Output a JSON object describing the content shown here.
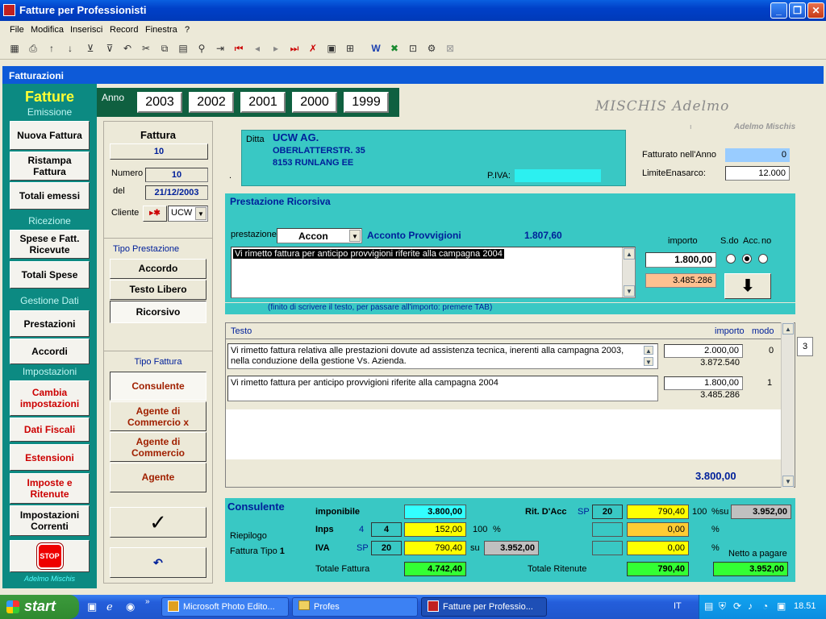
{
  "window": {
    "title": "Fatture per Professionisti"
  },
  "menu": [
    "File",
    "Modifica",
    "Inserisci",
    "Record",
    "Finestra",
    "?"
  ],
  "form": {
    "title": "Fatturazioni"
  },
  "nav": {
    "fatture": "Fatture",
    "emissione": "Emissione",
    "nuova_fattura": "Nuova Fattura",
    "ristampa_fattura": "Ristampa Fattura",
    "totali_emessi": "Totali emessi",
    "ricezione": "Ricezione",
    "spese_ricevute": "Spese e Fatt. Ricevute",
    "totali_spese": "Totali Spese",
    "gestione_dati": "Gestione Dati",
    "prestazioni": "Prestazioni",
    "accordi": "Accordi",
    "impostazioni": "Impostazioni",
    "cambia_impostazioni": "Cambia impostazioni",
    "dati_fiscali": "Dati Fiscali",
    "estensioni": "Estensioni",
    "imposte_ritenute": "Imposte e Ritenute",
    "impostazioni_correnti": "Impostazioni Correnti",
    "stop": "STOP",
    "signature": "Adelmo Mischis"
  },
  "years": {
    "label": "Anno",
    "items": [
      "2003",
      "2002",
      "2001",
      "2000",
      "1999"
    ]
  },
  "header": {
    "name": "MISCHIS Adelmo",
    "name_small": "Adelmo Mischis",
    "mark": "ı"
  },
  "invoice": {
    "fattura_label": "Fattura",
    "fattura_value": "10",
    "numero_label": "Numero",
    "numero_value": "10",
    "del_label": "del",
    "del_value": "21/12/2003",
    "cliente_label": "Cliente",
    "cliente_value": "UCW"
  },
  "ditta": {
    "label": "Ditta",
    "line1": "UCW AG.",
    "line2": "OBERLATTERSTR. 35",
    "line3": "8153 RUNLANG  EE",
    "piva_label": "P.IVA:",
    "dot": "."
  },
  "fatturato": {
    "label": "Fatturato nell'Anno",
    "value": "0",
    "limite_label": "LimiteEnasarco:",
    "limite_value": "12.000"
  },
  "tipo_prestazione": {
    "label": "Tipo Prestazione",
    "accordo": "Accordo",
    "testo_libero": "Testo Libero",
    "ricorsivo": "Ricorsivo"
  },
  "tipo_fattura": {
    "label": "Tipo Fattura",
    "consulente": "Consulente",
    "agente_x": "Agente di Commercio x",
    "agente_comm": "Agente di Commercio",
    "agente": "Agente"
  },
  "prestazione_ricorsiva": {
    "title": "Prestazione Ricorsiva",
    "prestazione_label": "prestazione",
    "prestazione_value": "Accon",
    "description": "Acconto Provvigioni",
    "amount": "1.807,60",
    "importo_label": "importo",
    "sdo_label": "S.do",
    "acc_label": "Acc.",
    "no_label": "no",
    "text": "Vi rimetto fattura per anticipo provvigioni riferite alla campagna 2004",
    "importo_value": "1.800,00",
    "saldo_value": "3.485.286",
    "hint": "(finito di scrivere il testo, per passare all'importo: premere TAB)"
  },
  "righe": {
    "testo_label": "Testo",
    "importo_label": "importo",
    "modo_label": "modo",
    "rows": [
      {
        "text": "Vi rimetto fattura relativa alle prestazioni dovute ad assistenza tecnica, inerenti alla campagna 2003, nella conduzione della  gestione Vs. Azienda.",
        "importo": "2.000,00",
        "sub": "3.872.540",
        "modo": "0"
      },
      {
        "text": "Vi rimetto fattura per anticipo provvigioni riferite alla campagna 2004",
        "importo": "1.800,00",
        "sub": "3.485.286",
        "modo": "1"
      }
    ],
    "total": "3.800,00",
    "side_value": "3"
  },
  "riepilogo": {
    "title": "Consulente",
    "riepilogo_label": "Riepilogo",
    "fattura_tipo": "Fattura Tipo",
    "fattura_tipo_num": "1",
    "imponibile_label": "imponibile",
    "imponibile_value": "3.800,00",
    "inps_label": "Inps",
    "inps_small": "4",
    "inps_box": "4",
    "inps_value": "152,00",
    "inps_pct": "100",
    "pct_sign": "%",
    "iva_label": "IVA",
    "iva_sp": "SP",
    "iva_box": "20",
    "iva_value": "790,40",
    "su_label": "su",
    "iva_su": "3.952,00",
    "totale_fattura_label": "Totale Fattura",
    "totale_fattura_value": "4.742,40",
    "rit_label": "Rit. D'Acc",
    "rit_sp": "SP",
    "rit_box": "20",
    "rit_value": "790,40",
    "rit_pct": "100",
    "rit_su_label": "%su",
    "rit_su_value": "3.952,00",
    "rit2_value": "0,00",
    "rit3_value": "0,00",
    "totale_ritenute_label": "Totale Ritenute",
    "totale_ritenute_value": "790,40",
    "netto_label": "Netto a pagare",
    "netto_value": "3.952,00"
  },
  "taskbar": {
    "start": "start",
    "tasks": [
      "Microsoft Photo Edito...",
      "Profes",
      "Fatture per Professio..."
    ],
    "lang": "IT",
    "clock": "18.51"
  },
  "colors": {
    "teal": "#0c8a82",
    "cyan": "#39c8c4",
    "yellow": "#ffff00",
    "green": "#33ff33",
    "orange": "#ffcc66",
    "lightblue": "#99ccff"
  }
}
